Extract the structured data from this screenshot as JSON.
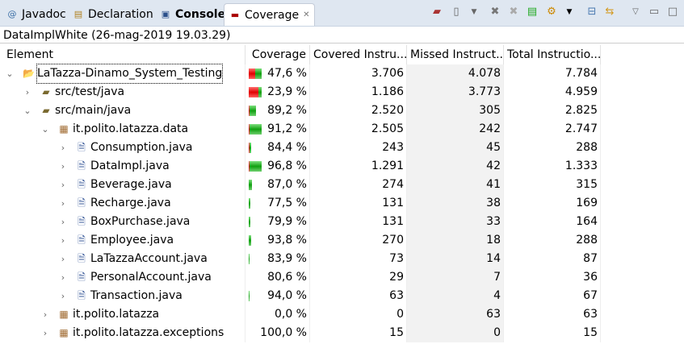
{
  "tabs": [
    {
      "label": "Javadoc",
      "icon": "at-icon"
    },
    {
      "label": "Declaration",
      "icon": "declaration-icon"
    },
    {
      "label": "Console",
      "icon": "console-icon"
    },
    {
      "label": "Coverage",
      "icon": "coverage-icon",
      "active": true
    }
  ],
  "session": "DataImplWhite (26-mag-2019 19.03.29)",
  "columns": [
    "Element",
    "Coverage",
    "Covered Instru...",
    "Missed Instruct...",
    "Total Instructio..."
  ],
  "colors": {
    "red": "#e00000",
    "green": "#10a010",
    "sorted_bg": "#f2f2f2"
  },
  "rows": [
    {
      "level": 0,
      "expanded": true,
      "icon": "project-icon",
      "name": "LaTazza-Dinamo_System_Testing",
      "coverage": "47,6 %",
      "covered": "3.706",
      "missed": "4.078",
      "total": "7.784",
      "group": "root"
    },
    {
      "level": 1,
      "expanded": false,
      "icon": "source-folder-icon",
      "name": "src/test/java",
      "coverage": "23,9 %",
      "covered": "1.186",
      "missed": "3.773",
      "total": "4.959",
      "group": "src"
    },
    {
      "level": 1,
      "expanded": true,
      "icon": "source-folder-icon",
      "name": "src/main/java",
      "coverage": "89,2 %",
      "covered": "2.520",
      "missed": "305",
      "total": "2.825",
      "group": "src"
    },
    {
      "level": 2,
      "expanded": true,
      "icon": "package-icon",
      "name": "it.polito.latazza.data",
      "coverage": "91,2 %",
      "covered": "2.505",
      "missed": "242",
      "total": "2.747",
      "group": "pkg"
    },
    {
      "level": 3,
      "expanded": false,
      "icon": "java-file-icon",
      "name": "Consumption.java",
      "coverage": "84,4 %",
      "covered": "243",
      "missed": "45",
      "total": "288",
      "group": "file"
    },
    {
      "level": 3,
      "expanded": false,
      "icon": "java-file-icon",
      "name": "DataImpl.java",
      "coverage": "96,8 %",
      "covered": "1.291",
      "missed": "42",
      "total": "1.333",
      "group": "file"
    },
    {
      "level": 3,
      "expanded": false,
      "icon": "java-file-icon",
      "name": "Beverage.java",
      "coverage": "87,0 %",
      "covered": "274",
      "missed": "41",
      "total": "315",
      "group": "file"
    },
    {
      "level": 3,
      "expanded": false,
      "icon": "java-file-icon",
      "name": "Recharge.java",
      "coverage": "77,5 %",
      "covered": "131",
      "missed": "38",
      "total": "169",
      "group": "file"
    },
    {
      "level": 3,
      "expanded": false,
      "icon": "java-file-icon",
      "name": "BoxPurchase.java",
      "coverage": "79,9 %",
      "covered": "131",
      "missed": "33",
      "total": "164",
      "group": "file"
    },
    {
      "level": 3,
      "expanded": false,
      "icon": "java-file-icon",
      "name": "Employee.java",
      "coverage": "93,8 %",
      "covered": "270",
      "missed": "18",
      "total": "288",
      "group": "file"
    },
    {
      "level": 3,
      "expanded": false,
      "icon": "java-file-icon",
      "name": "LaTazzaAccount.java",
      "coverage": "83,9 %",
      "covered": "73",
      "missed": "14",
      "total": "87",
      "group": "file"
    },
    {
      "level": 3,
      "expanded": false,
      "icon": "java-file-icon",
      "name": "PersonalAccount.java",
      "coverage": "80,6 %",
      "covered": "29",
      "missed": "7",
      "total": "36",
      "group": "file"
    },
    {
      "level": 3,
      "expanded": false,
      "icon": "java-file-icon",
      "name": "Transaction.java",
      "coverage": "94,0 %",
      "covered": "63",
      "missed": "4",
      "total": "67",
      "group": "file"
    },
    {
      "level": 2,
      "expanded": false,
      "icon": "package-icon",
      "name": "it.polito.latazza",
      "coverage": "0,0 %",
      "covered": "0",
      "missed": "63",
      "total": "63",
      "group": "pkg"
    },
    {
      "level": 2,
      "expanded": false,
      "icon": "package-icon",
      "name": "it.polito.latazza.exceptions",
      "coverage": "100,0 %",
      "covered": "15",
      "missed": "0",
      "total": "15",
      "group": "pkg"
    }
  ]
}
